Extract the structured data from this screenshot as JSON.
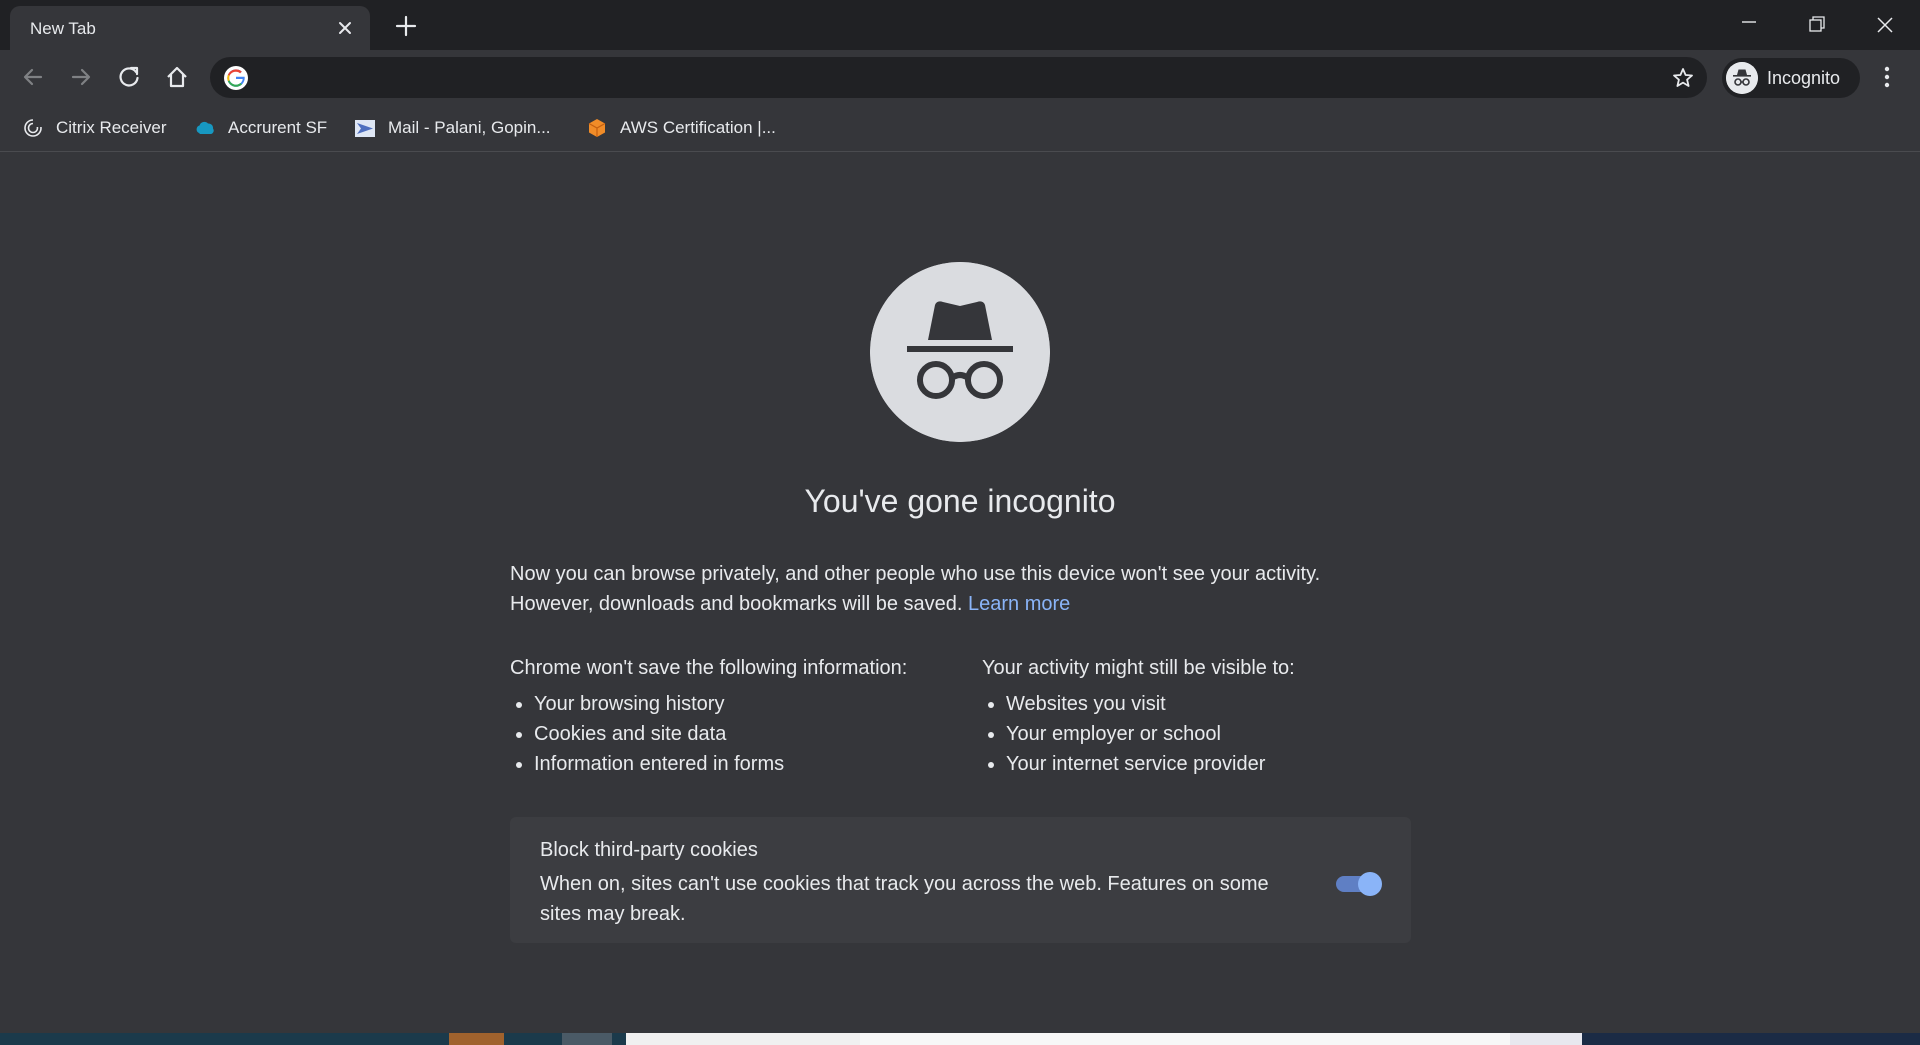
{
  "tab": {
    "title": "New Tab"
  },
  "toolbar": {
    "omnibox_value": "",
    "profile_label": "Incognito"
  },
  "bookmarks": [
    {
      "label": "Citrix Receiver",
      "icon": "citrix-icon"
    },
    {
      "label": "Accrurent SF",
      "icon": "salesforce-cloud-icon"
    },
    {
      "label": "Mail - Palani, Gopin...",
      "icon": "mail-icon"
    },
    {
      "label": "AWS Certification |...",
      "icon": "aws-cube-icon"
    }
  ],
  "content": {
    "headline": "You've gone incognito",
    "subtitle_line1": "Now you can browse privately, and other people who use this device won't see your activity.",
    "subtitle_line2": "However, downloads and bookmarks will be saved.",
    "learn_more": "Learn more",
    "not_saved_heading": "Chrome won't save the following information:",
    "not_saved_items": [
      "Your browsing history",
      "Cookies and site data",
      "Information entered in forms"
    ],
    "visible_heading": "Your activity might still be visible to:",
    "visible_items": [
      "Websites you visit",
      "Your employer or school",
      "Your internet service provider"
    ],
    "cookie_title": "Block third-party cookies",
    "cookie_desc": "When on, sites can't use cookies that track you across the web. Features on some sites may break.",
    "cookie_toggle_on": true
  },
  "colors": {
    "accent": "#8ab4f8",
    "background": "#35363a",
    "frame": "#202124"
  }
}
